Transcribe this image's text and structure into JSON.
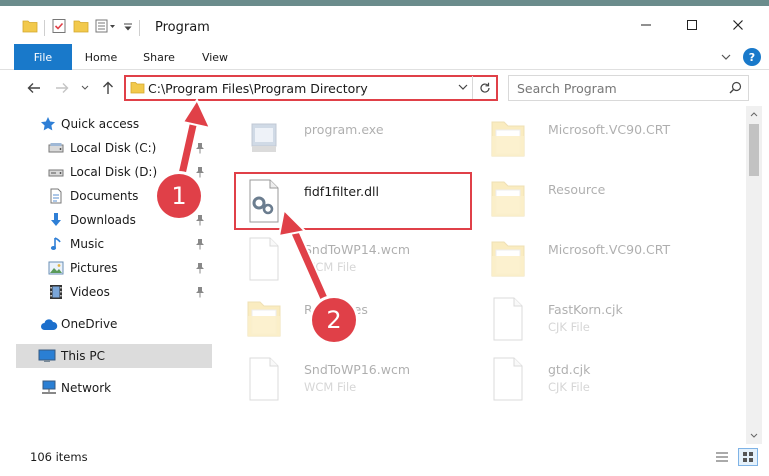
{
  "window": {
    "title": "Program"
  },
  "ribbon": {
    "tabs": [
      {
        "label": "File"
      },
      {
        "label": "Home"
      },
      {
        "label": "Share"
      },
      {
        "label": "View"
      }
    ],
    "help": "?"
  },
  "address": {
    "path": "C:\\Program Files\\Program Directory",
    "search_placeholder": "Search Program"
  },
  "sidebar": {
    "items": [
      {
        "label": "Quick access",
        "icon": "star-icon"
      },
      {
        "label": "Local Disk (C:)",
        "icon": "drive-icon",
        "pinned": true
      },
      {
        "label": "Local Disk (D:)",
        "icon": "drive-icon",
        "pinned": true
      },
      {
        "label": "Documents",
        "icon": "document-icon",
        "pinned": true
      },
      {
        "label": "Downloads",
        "icon": "download-icon",
        "pinned": true
      },
      {
        "label": "Music",
        "icon": "music-icon",
        "pinned": true
      },
      {
        "label": "Pictures",
        "icon": "pictures-icon",
        "pinned": true
      },
      {
        "label": "Videos",
        "icon": "video-icon",
        "pinned": true
      },
      {
        "label": "OneDrive",
        "icon": "cloud-icon"
      },
      {
        "label": "This PC",
        "icon": "computer-icon",
        "selected": true
      },
      {
        "label": "Network",
        "icon": "network-icon"
      }
    ]
  },
  "files": {
    "left": [
      {
        "name": "program.exe",
        "type": "",
        "icon": "exe-icon"
      },
      {
        "name": "fidf1filter.dll",
        "type": "",
        "icon": "dll-icon"
      },
      {
        "name": "SndToWP14.wcm",
        "type": "WCM File",
        "icon": "blank-file-icon"
      },
      {
        "name": "Resources",
        "type": "",
        "icon": "folder-icon"
      },
      {
        "name": "SndToWP16.wcm",
        "type": "WCM File",
        "icon": "blank-file-icon"
      }
    ],
    "right": [
      {
        "name": "Microsoft.VC90.CRT",
        "type": "",
        "icon": "folder-icon"
      },
      {
        "name": "Resource",
        "type": "",
        "icon": "folder-icon"
      },
      {
        "name": "Microsoft.VC90.CRT",
        "type": "",
        "icon": "folder-icon"
      },
      {
        "name": "FastKorn.cjk",
        "type": "CJK File",
        "icon": "blank-file-icon"
      },
      {
        "name": "gtd.cjk",
        "type": "CJK File",
        "icon": "blank-file-icon"
      }
    ]
  },
  "status": {
    "count": "106 items"
  },
  "annotations": {
    "step1": "1",
    "step2": "2"
  },
  "colors": {
    "accent": "#1979ca",
    "annotation": "#e04048",
    "folder": "#f2c94c"
  }
}
